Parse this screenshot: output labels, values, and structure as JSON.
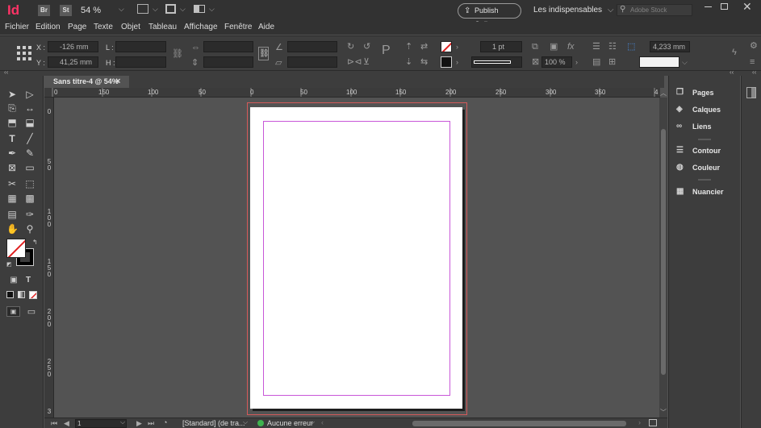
{
  "app": {
    "logo": "Id",
    "bridge_label": "Br",
    "stock_label": "St",
    "zoom": "54 %",
    "publish_label": "Publish Online",
    "workspace": "Les indispensables",
    "search_placeholder": "Adobe Stock"
  },
  "menu": [
    "Fichier",
    "Edition",
    "Page",
    "Texte",
    "Objet",
    "Tableau",
    "Affichage",
    "Fenêtre",
    "Aide"
  ],
  "control": {
    "x_label": "X :",
    "x_value": "-126 mm",
    "y_label": "Y :",
    "y_value": "41,25 mm",
    "w_label": "L :",
    "h_label": "H :",
    "stroke_weight": "1 pt",
    "opacity": "100 %",
    "gutter": "4,233 mm"
  },
  "document": {
    "tab_title": "Sans titre-4 @ 54%",
    "close_glyph": "×"
  },
  "ruler": {
    "h_ticks": [
      "0",
      "150",
      "100",
      "50",
      "0",
      "50",
      "100",
      "150",
      "200",
      "250",
      "300",
      "350",
      "4"
    ],
    "v_ticks": [
      "0",
      "5\n0",
      "1\n0\n0",
      "1\n5\n0",
      "2\n0\n0",
      "2\n5\n0",
      "3"
    ]
  },
  "status": {
    "page": "1",
    "style": "[Standard] (de tra...",
    "preflight": "Aucune erreur",
    "preflight_color": "#3fb34f"
  },
  "panels": [
    {
      "label": "Pages",
      "icon": "pages-icon"
    },
    {
      "label": "Calques",
      "icon": "layers-icon"
    },
    {
      "label": "Liens",
      "icon": "links-icon"
    },
    {
      "label": "Contour",
      "icon": "stroke-icon"
    },
    {
      "label": "Couleur",
      "icon": "color-icon"
    },
    {
      "label": "Nuancier",
      "icon": "swatches-icon"
    }
  ],
  "colors": {
    "accent_logo": "#ff3366",
    "bleed_guide": "#d45a5a",
    "margin_guide": "#c857d8"
  }
}
